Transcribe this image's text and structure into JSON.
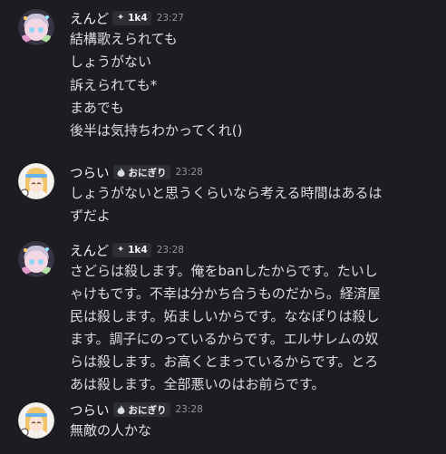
{
  "colors": {
    "background": "#1c1c21",
    "username": "#f2f3f5",
    "text": "#dbdee1",
    "timestamp": "#94959c",
    "tag_bg": "#2e2f35"
  },
  "messages": [
    {
      "author": "えんど",
      "tag_icon": "sparkle-icon",
      "tag": "1k4",
      "time": "23:27",
      "lines": [
        "結構歌えられても",
        "しょうがない",
        "訴えられても*",
        "まあでも",
        "後半は気持ちわかってくれ()"
      ]
    },
    {
      "author": "つらい",
      "tag_icon": "fire-icon",
      "tag": "おにぎり",
      "time": "23:28",
      "lines": [
        "しょうがないと思うくらいなら考える時間はあるは",
        "ずだよ"
      ]
    },
    {
      "author": "えんど",
      "tag_icon": "sparkle-icon",
      "tag": "1k4",
      "time": "23:28",
      "lines": [
        "さどらは殺します。俺をbanしたからです。たいし",
        "ゃけもです。不幸は分かち合うものだから。経済屋",
        "民は殺します。妬ましいからです。ななぽりは殺し",
        "ます。調子にのっているからです。エルサレムの奴",
        "らは殺します。お高くとまっているからです。とろ",
        "あは殺します。全部悪いのはお前らです。"
      ]
    },
    {
      "author": "つらい",
      "tag_icon": "fire-icon",
      "tag": "おにぎり",
      "time": "23:28",
      "lines": [
        "無敵の人かな"
      ]
    }
  ]
}
